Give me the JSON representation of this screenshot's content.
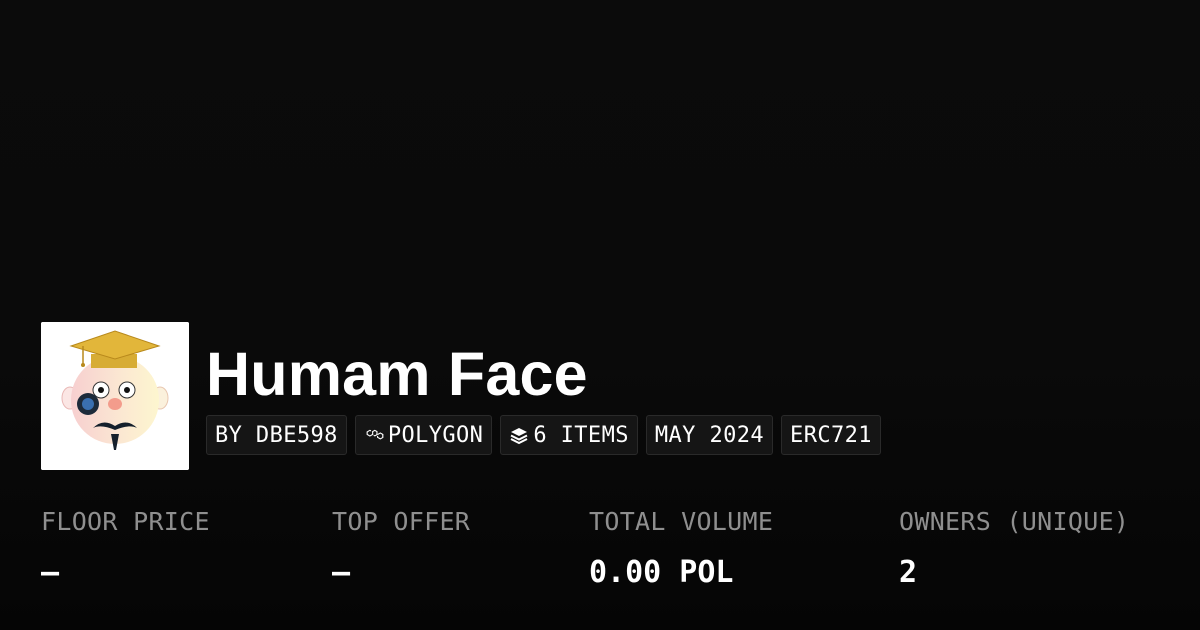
{
  "collection": {
    "name": "Humam Face",
    "image_alt": "Humam Face collection avatar",
    "tags": {
      "creator": "BY DBE598",
      "chain": "POLYGON",
      "chain_icon": "polygon-icon",
      "items": "6 ITEMS",
      "items_icon": "layers-icon",
      "date": "MAY 2024",
      "standard": "ERC721"
    }
  },
  "stats": [
    {
      "label": "FLOOR PRICE",
      "value": "–"
    },
    {
      "label": "TOP OFFER",
      "value": "–"
    },
    {
      "label": "TOTAL VOLUME",
      "value": "0.00 POL"
    },
    {
      "label": "OWNERS (UNIQUE)",
      "value": "2"
    }
  ]
}
